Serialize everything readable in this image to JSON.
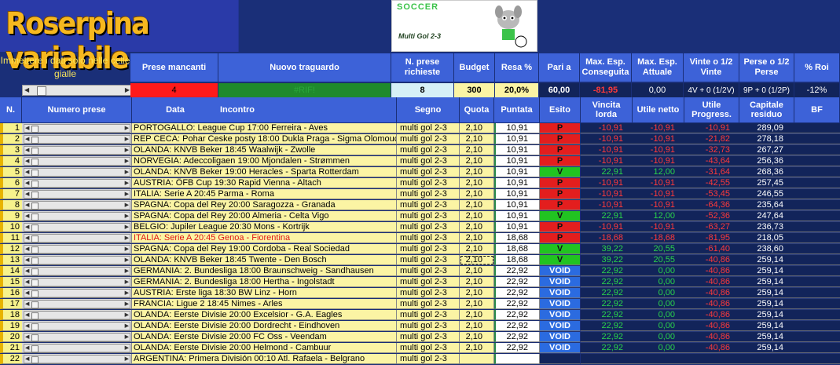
{
  "app": {
    "title": "Roserpina variabile",
    "logo_title": "SOCCER",
    "logo_subtitle": "Multi Gol 2-3",
    "hint": "Immettere i dati solo nelle celle gialle"
  },
  "summary_headers": {
    "prese_mancanti": "Prese mancanti",
    "nuovo_traguardo": "Nuovo traguardo",
    "n_prese": "N. prese richieste",
    "budget": "Budget",
    "resa": "Resa %",
    "pari_a": "Pari a",
    "max_esp_conseguita": "Max. Esp. Conseguita",
    "max_esp_attuale": "Max. Esp. Attuale",
    "vinte": "Vinte o 1/2 Vinte",
    "perse": "Perse o 1/2 Perse",
    "roi": "% Roi"
  },
  "summary_values": {
    "prese_mancanti": "4",
    "nuovo_traguardo": "#RIF!",
    "n_prese": "8",
    "budget": "300",
    "resa": "20,0%",
    "pari_a": "60,00",
    "max_esp_conseguita": "-81,95",
    "max_esp_attuale": "0,00",
    "vinte": "4V + 0 (1/2V)",
    "perse": "9P + 0 (1/2P)",
    "roi": "-12%"
  },
  "colors": {
    "blue_header": "#3d62d8",
    "dark_bg": "#1a2f78",
    "cell_yellow": "#fbf4a4",
    "win": "#21c321",
    "loss": "#e31e1e",
    "void": "#2b6be0"
  },
  "columns": {
    "n": "N.",
    "numero_prese": "Numero prese",
    "data": "Data",
    "incontro": "Incontro",
    "segno": "Segno",
    "quota": "Quota",
    "puntata": "Puntata",
    "esito": "Esito",
    "vincita_lorda": "Vincita lorda",
    "utile_netto": "Utile netto",
    "utile_progress": "Utile Progress.",
    "capitale_residuo": "Capitale residuo",
    "bf": "BF"
  },
  "rows": [
    {
      "n": "1",
      "match": "PORTOGALLO: League Cup 17:00 Ferreira - Aves",
      "segno": "multi gol 2-3",
      "quota": "2,10",
      "puntata": "10,91",
      "esito": "P",
      "vincita": "-10,91",
      "utile": "-10,91",
      "progress": "-10,91",
      "capitale": "289,09"
    },
    {
      "n": "2",
      "match": "REP CECA: Pohar Ceske posty 18:00 Dukla Praga - Sigma Olomouc",
      "segno": "multi gol 2-3",
      "quota": "2,10",
      "puntata": "10,91",
      "esito": "P",
      "vincita": "-10,91",
      "utile": "-10,91",
      "progress": "-21,82",
      "capitale": "278,18"
    },
    {
      "n": "3",
      "match": "OLANDA: KNVB Beker 18:45 Waalwijk - Zwolle",
      "segno": "multi gol 2-3",
      "quota": "2,10",
      "puntata": "10,91",
      "esito": "P",
      "vincita": "-10,91",
      "utile": "-10,91",
      "progress": "-32,73",
      "capitale": "267,27"
    },
    {
      "n": "4",
      "match": "NORVEGIA: Adeccoligaen 19:00 Mjondalen - Strømmen",
      "segno": "multi gol 2-3",
      "quota": "2,10",
      "puntata": "10,91",
      "esito": "P",
      "vincita": "-10,91",
      "utile": "-10,91",
      "progress": "-43,64",
      "capitale": "256,36"
    },
    {
      "n": "5",
      "match": "OLANDA: KNVB Beker 19:00 Heracles - Sparta Rotterdam",
      "segno": "multi gol 2-3",
      "quota": "2,10",
      "puntata": "10,91",
      "esito": "V",
      "vincita": "22,91",
      "utile": "12,00",
      "progress": "-31,64",
      "capitale": "268,36"
    },
    {
      "n": "6",
      "match": "AUSTRIA: ÖFB Cup 19:30 Rapid Vienna - Altach",
      "segno": "multi gol 2-3",
      "quota": "2,10",
      "puntata": "10,91",
      "esito": "P",
      "vincita": "-10,91",
      "utile": "-10,91",
      "progress": "-42,55",
      "capitale": "257,45"
    },
    {
      "n": "7",
      "match": "ITALIA: Serie A 20:45 Parma - Roma",
      "segno": "multi gol 2-3",
      "quota": "2,10",
      "puntata": "10,91",
      "esito": "P",
      "vincita": "-10,91",
      "utile": "-10,91",
      "progress": "-53,45",
      "capitale": "246,55"
    },
    {
      "n": "8",
      "match": "SPAGNA: Copa del Rey 20:00 Saragozza - Granada",
      "segno": "multi gol 2-3",
      "quota": "2,10",
      "puntata": "10,91",
      "esito": "P",
      "vincita": "-10,91",
      "utile": "-10,91",
      "progress": "-64,36",
      "capitale": "235,64"
    },
    {
      "n": "9",
      "match": "SPAGNA: Copa del Rey 20:00 Almeria - Celta Vigo",
      "segno": "multi gol 2-3",
      "quota": "2,10",
      "puntata": "10,91",
      "esito": "V",
      "vincita": "22,91",
      "utile": "12,00",
      "progress": "-52,36",
      "capitale": "247,64"
    },
    {
      "n": "10",
      "match": "BELGIO: Jupiler League 20:30 Mons - Kortrijk",
      "segno": "multi gol 2-3",
      "quota": "2,10",
      "puntata": "10,91",
      "esito": "P",
      "vincita": "-10,91",
      "utile": "-10,91",
      "progress": "-63,27",
      "capitale": "236,73"
    },
    {
      "n": "11",
      "match": "ITALIA: Serie A 20:45 Genoa - Fiorentina",
      "segno": "multi gol 2-3",
      "quota": "2,10",
      "puntata": "18,68",
      "esito": "P",
      "vincita": "-18,68",
      "utile": "-18,68",
      "progress": "-81,95",
      "capitale": "218,05",
      "red": true
    },
    {
      "n": "12",
      "match": "SPAGNA: Copa del Rey 19:00 Cordoba - Real Sociedad",
      "segno": "multi gol 2-3",
      "quota": "2,10",
      "puntata": "18,68",
      "esito": "V",
      "vincita": "39,22",
      "utile": "20,55",
      "progress": "-61,40",
      "capitale": "238,60"
    },
    {
      "n": "13",
      "match": "OLANDA: KNVB Beker 18:45 Twente - Den Bosch",
      "segno": "multi gol 2-3",
      "quota": "2,10",
      "puntata": "18,68",
      "esito": "V",
      "vincita": "39,22",
      "utile": "20,55",
      "progress": "-40,86",
      "capitale": "259,14",
      "dashed": true
    },
    {
      "n": "14",
      "match": "GERMANIA: 2. Bundesliga 18:00 Braunschweig - Sandhausen",
      "segno": "multi gol 2-3",
      "quota": "2,10",
      "puntata": "22,92",
      "esito": "VOID",
      "vincita": "22,92",
      "utile": "0,00",
      "progress": "-40,86",
      "capitale": "259,14"
    },
    {
      "n": "15",
      "match": "GERMANIA: 2. Bundesliga 18:00 Hertha - Ingolstadt",
      "segno": "multi gol 2-3",
      "quota": "2,10",
      "puntata": "22,92",
      "esito": "VOID",
      "vincita": "22,92",
      "utile": "0,00",
      "progress": "-40,86",
      "capitale": "259,14"
    },
    {
      "n": "16",
      "match": "AUSTRIA: Erste liga 18:30 BW Linz - Horn",
      "segno": "multi gol 2-3",
      "quota": "2,10",
      "puntata": "22,92",
      "esito": "VOID",
      "vincita": "22,92",
      "utile": "0,00",
      "progress": "-40,86",
      "capitale": "259,14"
    },
    {
      "n": "17",
      "match": "FRANCIA: Ligue 2 18:45 Nimes - Arles",
      "segno": "multi gol 2-3",
      "quota": "2,10",
      "puntata": "22,92",
      "esito": "VOID",
      "vincita": "22,92",
      "utile": "0,00",
      "progress": "-40,86",
      "capitale": "259,14"
    },
    {
      "n": "18",
      "match": "OLANDA: Eerste Divisie 20:00 Excelsior - G.A. Eagles",
      "segno": "multi gol 2-3",
      "quota": "2,10",
      "puntata": "22,92",
      "esito": "VOID",
      "vincita": "22,92",
      "utile": "0,00",
      "progress": "-40,86",
      "capitale": "259,14"
    },
    {
      "n": "19",
      "match": "OLANDA: Eerste Divisie 20:00 Dordrecht - Eindhoven",
      "segno": "multi gol 2-3",
      "quota": "2,10",
      "puntata": "22,92",
      "esito": "VOID",
      "vincita": "22,92",
      "utile": "0,00",
      "progress": "-40,86",
      "capitale": "259,14"
    },
    {
      "n": "20",
      "match": "OLANDA: Eerste Divisie 20:00 FC Oss - Veendam",
      "segno": "multi gol 2-3",
      "quota": "2,10",
      "puntata": "22,92",
      "esito": "VOID",
      "vincita": "22,92",
      "utile": "0,00",
      "progress": "-40,86",
      "capitale": "259,14"
    },
    {
      "n": "21",
      "match": "OLANDA: Eerste Divisie 20:00 Helmond - Cambuur",
      "segno": "multi gol 2-3",
      "quota": "2,10",
      "puntata": "22,92",
      "esito": "VOID",
      "vincita": "22,92",
      "utile": "0,00",
      "progress": "-40,86",
      "capitale": "259,14"
    },
    {
      "n": "22",
      "match": "ARGENTINA: Primera División 00:10 Atl. Rafaela - Belgrano",
      "segno": "multi gol 2-3",
      "quota": "",
      "puntata": "",
      "esito": "",
      "vincita": "",
      "utile": "",
      "progress": "",
      "capitale": ""
    }
  ]
}
